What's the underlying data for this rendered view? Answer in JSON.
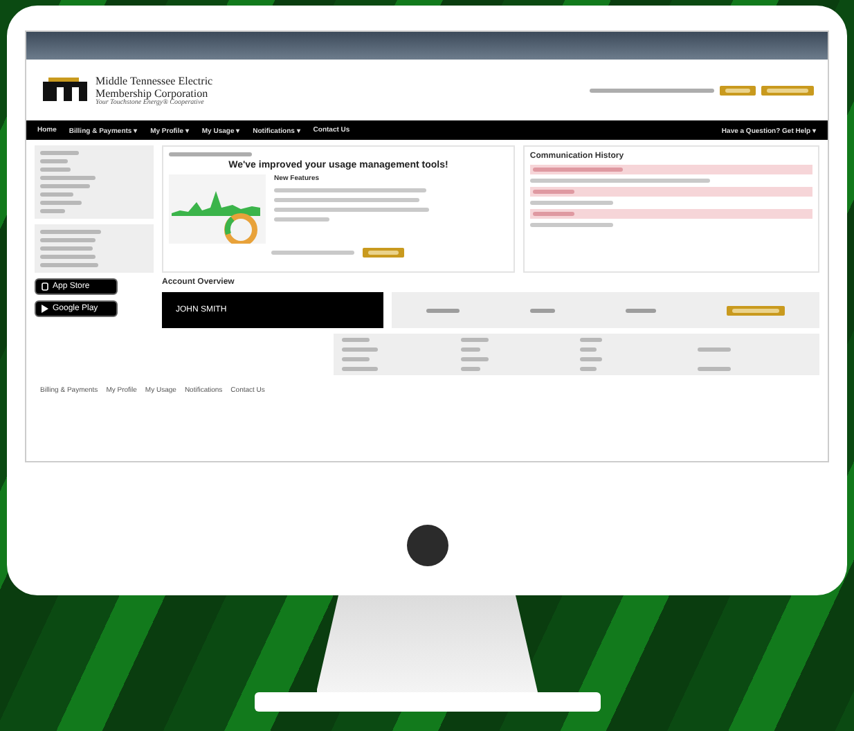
{
  "header": {
    "logo_lines": [
      "Middle Tennessee Electric",
      "Membership Corporation"
    ],
    "tagline": "Your Touchstone Energy® Cooperative"
  },
  "nav": {
    "items": [
      "Home",
      "Billing & Payments ▾",
      "My Profile ▾",
      "My Usage ▾",
      "Notifications ▾",
      "Contact Us"
    ],
    "help": "Have a Question? Get Help ▾"
  },
  "sidebar": {
    "badges": [
      "App Store",
      "Google Play"
    ]
  },
  "usage_panel": {
    "headline": "We've improved your usage management tools!",
    "subheading": "New Features"
  },
  "communication_panel": {
    "title": "Communication History"
  },
  "account_overview": {
    "title": "Account Overview",
    "name": "JOHN SMITH"
  },
  "footer": {
    "links": [
      "Billing & Payments",
      "My Profile",
      "My Usage",
      "Notifications",
      "Contact Us"
    ]
  }
}
